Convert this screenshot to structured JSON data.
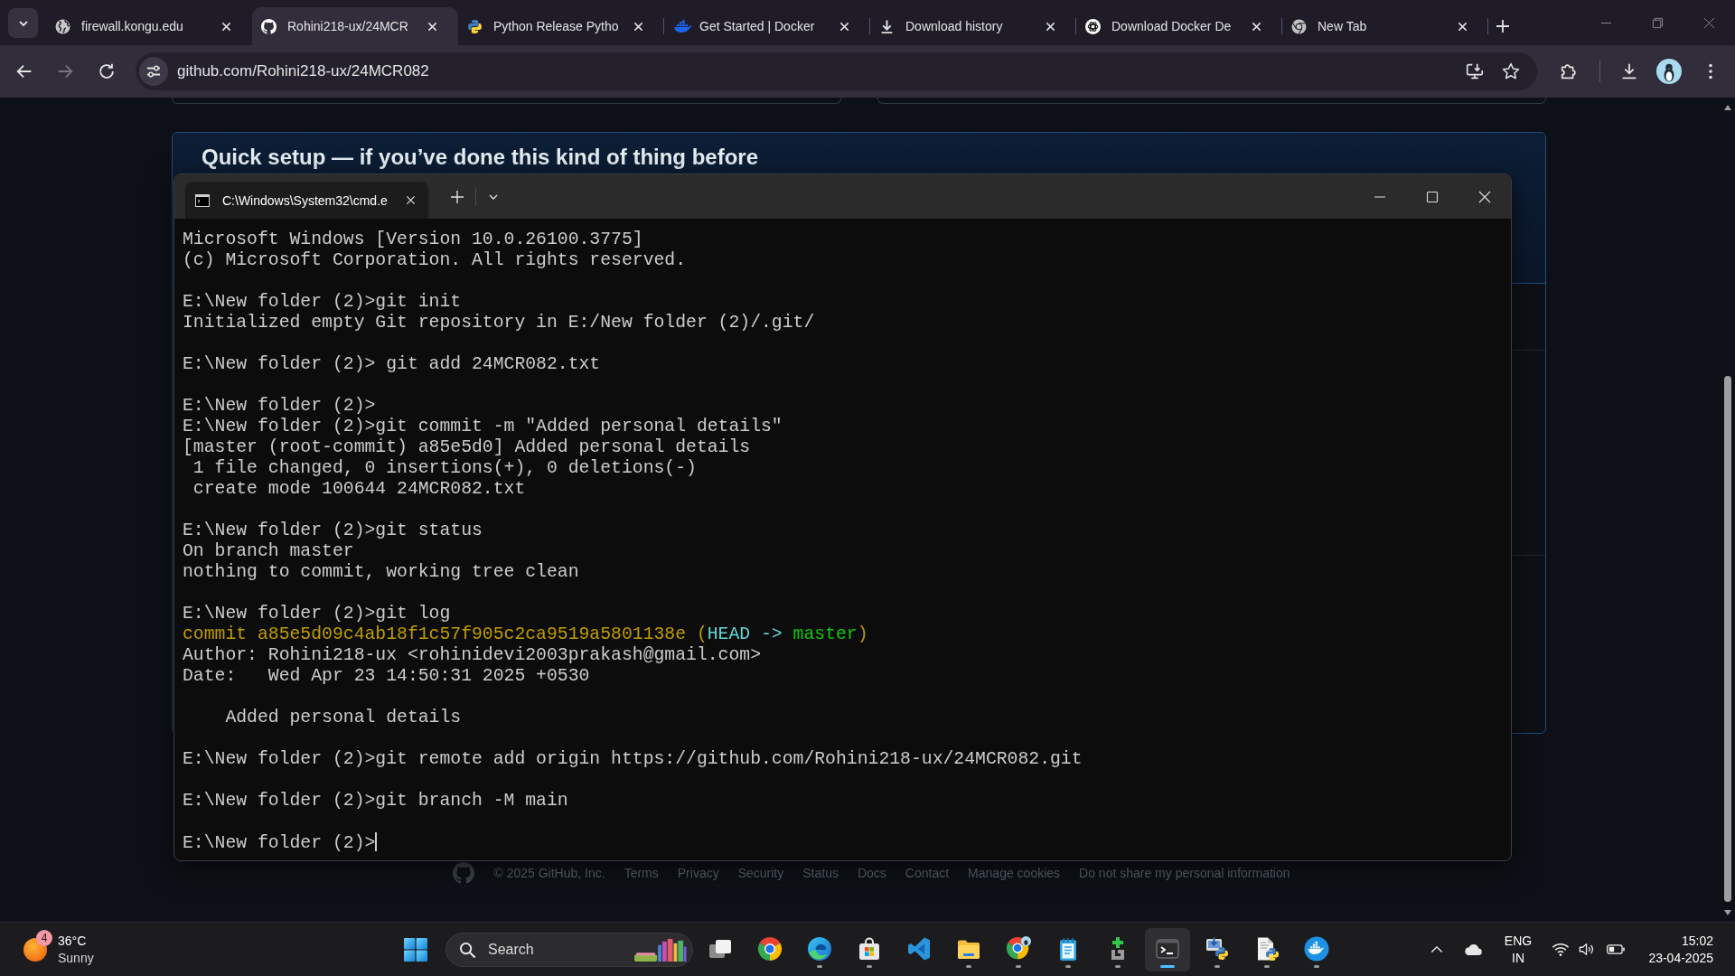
{
  "browser": {
    "tabs": [
      {
        "title": "firewall.kongu.edu",
        "selected": false
      },
      {
        "title": "Rohini218-ux/24MCR",
        "selected": true
      },
      {
        "title": "Python Release Pytho",
        "selected": false
      },
      {
        "title": "Get Started | Docker",
        "selected": false
      },
      {
        "title": "Download history",
        "selected": false
      },
      {
        "title": "Download Docker De",
        "selected": false
      },
      {
        "title": "New Tab",
        "selected": false
      }
    ],
    "back": {
      "disabled": false
    },
    "forward": {
      "disabled": true
    },
    "url": "github.com/Rohini218-ux/24MCR082"
  },
  "page": {
    "heading": "Quick setup — if you’ve done this kind of thing before",
    "footer": {
      "copyright": "© 2025 GitHub, Inc.",
      "links": [
        "Terms",
        "Privacy",
        "Security",
        "Status",
        "Docs",
        "Contact",
        "Manage cookies",
        "Do not share my personal information"
      ]
    }
  },
  "terminal": {
    "tab_title": "C:\\Windows\\System32\\cmd.e",
    "blocks": [
      {
        "lines": [
          {
            "kind": "text",
            "text": "Microsoft Windows [Version 10.0.26100.3775]"
          },
          {
            "kind": "text",
            "text": "(c) Microsoft Corporation. All rights reserved."
          }
        ]
      },
      {
        "lines": [
          {
            "kind": "text",
            "text": "E:\\New folder (2)>git init"
          },
          {
            "kind": "text",
            "text": "Initialized empty Git repository in E:/New folder (2)/.git/"
          }
        ]
      },
      {
        "lines": [
          {
            "kind": "text",
            "text": "E:\\New folder (2)> git add 24MCR082.txt"
          }
        ]
      },
      {
        "lines": [
          {
            "kind": "text",
            "text": "E:\\New folder (2)>"
          },
          {
            "kind": "text",
            "text": "E:\\New folder (2)>git commit -m \"Added personal details\""
          },
          {
            "kind": "text",
            "text": "[master (root-commit) a85e5d0] Added personal details"
          },
          {
            "kind": "text",
            "text": " 1 file changed, 0 insertions(+), 0 deletions(-)"
          },
          {
            "kind": "text",
            "text": " create mode 100644 24MCR082.txt"
          }
        ]
      },
      {
        "lines": [
          {
            "kind": "text",
            "text": "E:\\New folder (2)>git status"
          },
          {
            "kind": "text",
            "text": "On branch master"
          },
          {
            "kind": "text",
            "text": "nothing to commit, working tree clean"
          }
        ]
      },
      {
        "lines": [
          {
            "kind": "text",
            "text": "E:\\New folder (2)>git log"
          },
          {
            "kind": "colored",
            "parts": [
              {
                "text": "commit a85e5d09c4ab18f1c57f905c2ca9519a5801138e (",
                "color": "#c19c00"
              },
              {
                "text": "HEAD -> ",
                "color": "#61d6d6"
              },
              {
                "text": "master",
                "color": "#16c60c"
              },
              {
                "text": ")",
                "color": "#c19c00"
              }
            ]
          },
          {
            "kind": "text",
            "text": "Author: Rohini218-ux <rohinidevi2003prakash@gmail.com>"
          },
          {
            "kind": "text",
            "text": "Date:   Wed Apr 23 14:50:31 2025 +0530"
          }
        ]
      },
      {
        "lines": [
          {
            "kind": "text",
            "text": "    Added personal details"
          }
        ]
      },
      {
        "lines": [
          {
            "kind": "text",
            "text": "E:\\New folder (2)>git remote add origin https://github.com/Rohini218-ux/24MCR082.git"
          }
        ]
      },
      {
        "lines": [
          {
            "kind": "text",
            "text": "E:\\New folder (2)>git branch -M main"
          }
        ]
      },
      {
        "lines": [
          {
            "kind": "prompt",
            "text": "E:\\New folder (2)>",
            "cursor": true
          }
        ]
      }
    ]
  },
  "taskbar": {
    "weather": {
      "badge": "4",
      "temperature": "36°C",
      "condition": "Sunny"
    },
    "search": {
      "placeholder": "Search"
    },
    "apps": [
      {
        "running": false,
        "selected": false
      },
      {
        "running": false,
        "selected": false
      },
      {
        "running": true,
        "selected": false
      },
      {
        "running": true,
        "selected": false
      },
      {
        "running": false,
        "selected": false
      },
      {
        "running": true,
        "selected": false
      },
      {
        "running": true,
        "selected": false
      },
      {
        "running": true,
        "selected": false
      },
      {
        "running": true,
        "selected": false
      },
      {
        "running": true,
        "selected": true
      },
      {
        "running": true,
        "selected": false
      },
      {
        "running": true,
        "selected": false
      },
      {
        "running": true,
        "selected": false
      }
    ],
    "tray": {
      "language": "ENG",
      "region": "IN",
      "time": "15:02",
      "date": "23-04-2025"
    }
  }
}
